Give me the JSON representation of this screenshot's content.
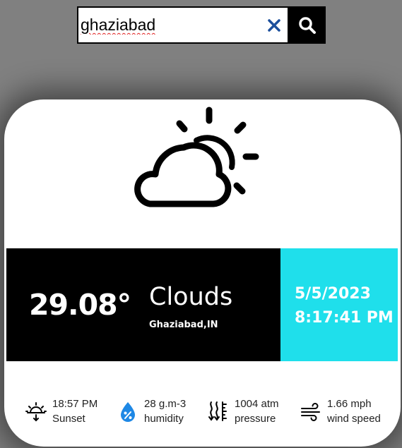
{
  "search": {
    "value": "ghaziabad",
    "clear_icon": "close-icon",
    "search_icon": "search-icon"
  },
  "weather": {
    "icon": "partly-cloudy-icon",
    "temperature": "29.08°",
    "condition": "Clouds",
    "location": "Ghaziabad,IN",
    "date": "5/5/2023",
    "time": "8:17:41 PM"
  },
  "stats": [
    {
      "icon": "sunset-icon",
      "value": "18:57 PM",
      "label": "Sunset"
    },
    {
      "icon": "humidity-icon",
      "value": "28 g.m-3",
      "label": "humidity"
    },
    {
      "icon": "pressure-icon",
      "value": "1004 atm",
      "label": "pressure"
    },
    {
      "icon": "wind-icon",
      "value": "1.66 mph",
      "label": "wind speed"
    }
  ],
  "colors": {
    "accent": "#1fdfeb",
    "band_dark": "#000000",
    "humidity_icon": "#1e88e5",
    "clear_icon": "#1c4f9c"
  }
}
